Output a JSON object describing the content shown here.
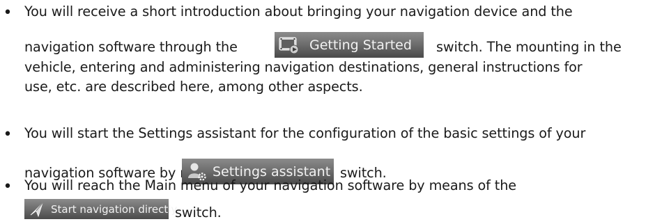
{
  "bullets": [
    {
      "lines": [
        "You will receive a short introduction about bringing your navigation device and the",
        "navigation software through the",
        "switch. The mounting in the",
        "vehicle, entering and administering navigation destinations, general instructions for",
        "use, etc. are described here, among other aspects."
      ],
      "button": {
        "label": "Getting Started",
        "icon": "film-strip-icon"
      }
    },
    {
      "lines": [
        "You will start the Settings assistant for the configuration of the basic settings of your",
        "navigation software by means of the",
        "switch."
      ],
      "button": {
        "label": "Settings assistant",
        "icon": "person-gear-icon"
      }
    },
    {
      "lines": [
        "You will reach the Main menu of your navigation software by means of the",
        "switch."
      ],
      "button": {
        "label": "Start navigation directly",
        "icon": "navigation-arrow-icon"
      }
    }
  ],
  "colors": {
    "text": "#1a1a1a",
    "button_top": "#8b8b8b",
    "button_bottom": "#4a4a4a",
    "button_text": "#f2f2f2"
  }
}
